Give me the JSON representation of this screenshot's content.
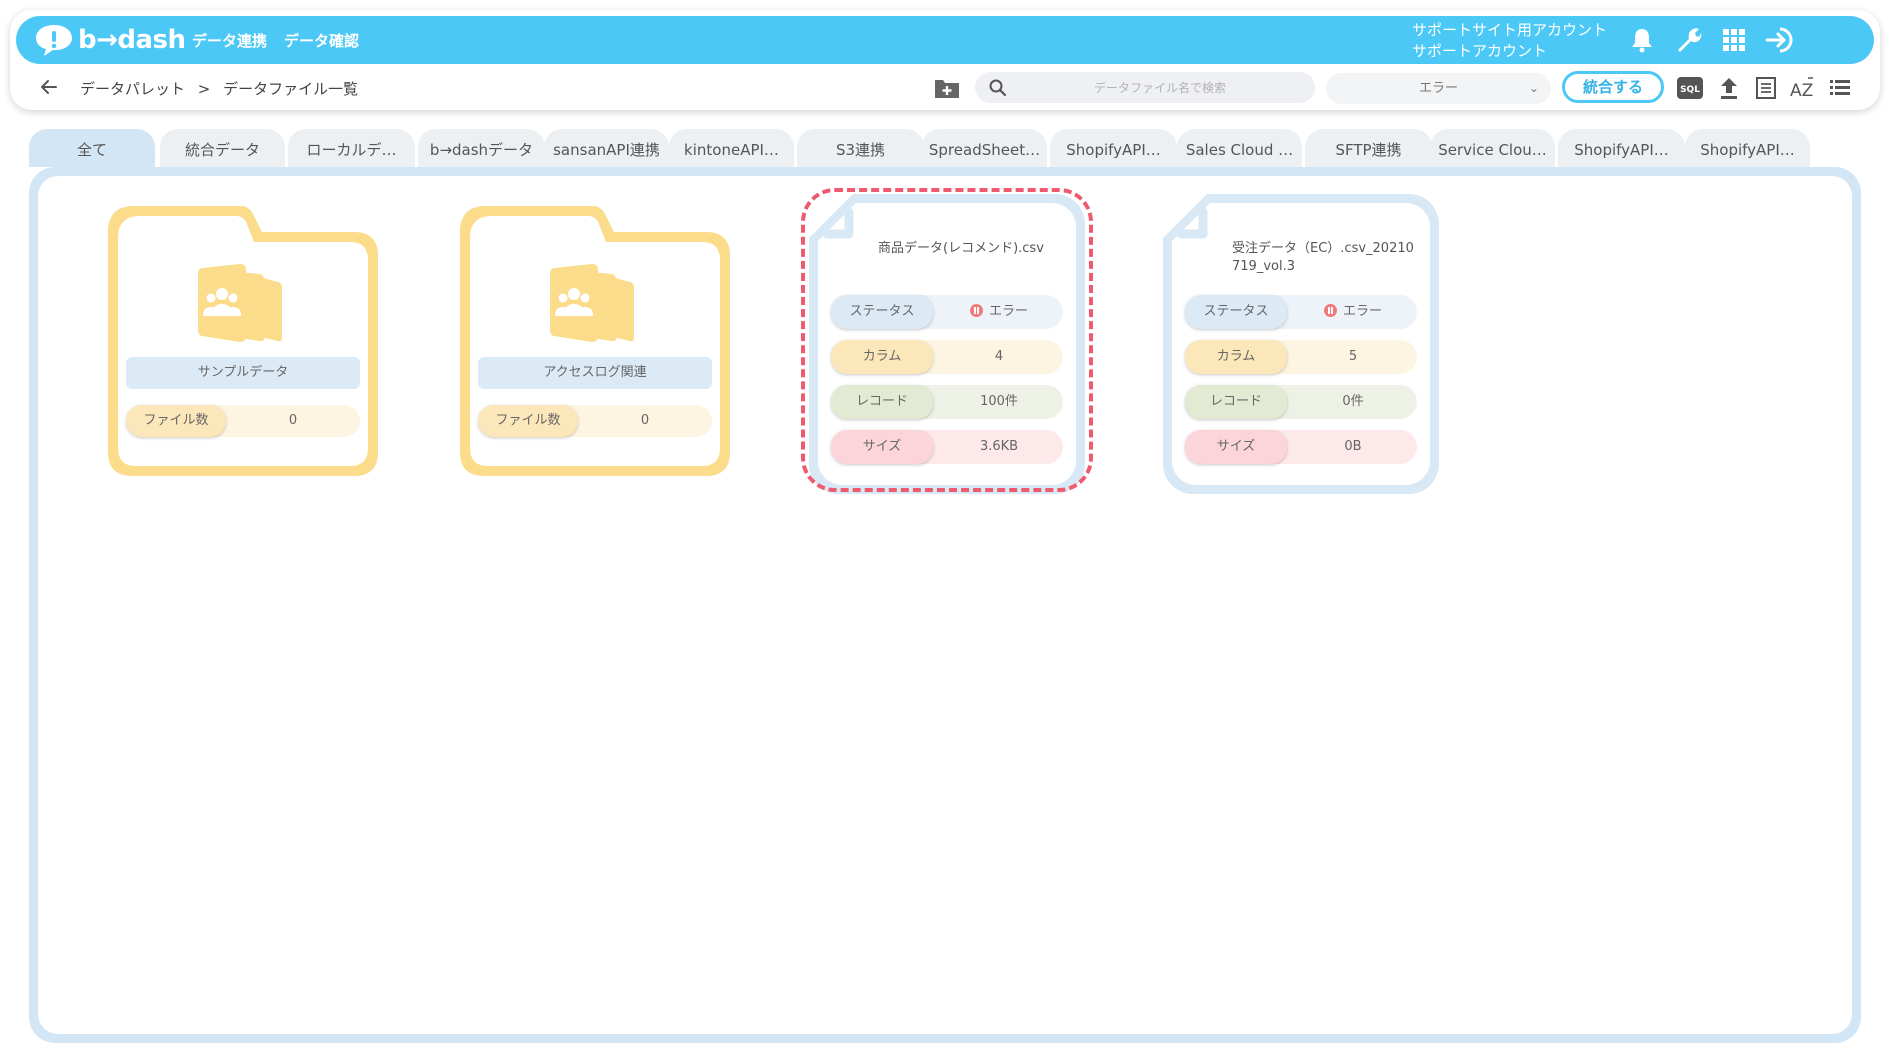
{
  "app": {
    "logo_text": "b→dash",
    "nav": [
      "データ連携",
      "データ確認"
    ],
    "account_line1": "サポートサイト用アカウント",
    "account_line2": "サポートアカウント"
  },
  "header_icons": [
    "bell-icon",
    "wrench-icon",
    "grid-apps-icon",
    "logout-icon"
  ],
  "breadcrumb": {
    "parent": "データパレット",
    "separator": ">",
    "current": "データファイル一覧"
  },
  "search": {
    "placeholder": "データファイル名で検索",
    "value": ""
  },
  "status_filter": {
    "selected": "エラー"
  },
  "merge_button": "統合する",
  "toolbar_icons": [
    "sql-icon",
    "upload-icon",
    "list-view-icon",
    "sort-az-icon",
    "menu-list-icon"
  ],
  "toolbar_labels": {
    "sql": "SQL",
    "az": "AZ"
  },
  "tabs": [
    {
      "label": "全て",
      "active": true
    },
    {
      "label": "統合データ"
    },
    {
      "label": "ローカルデ…"
    },
    {
      "label": "b→dashデータ"
    },
    {
      "label": "sansanAPI連携"
    },
    {
      "label": "kintoneAPI…"
    },
    {
      "label": "S3連携"
    },
    {
      "label": "SpreadSheet…"
    },
    {
      "label": "ShopifyAPI…"
    },
    {
      "label": "Sales Cloud …"
    },
    {
      "label": "SFTP連携"
    },
    {
      "label": "Service Clou…"
    },
    {
      "label": "ShopifyAPI…"
    },
    {
      "label": "ShopifyAPI…"
    }
  ],
  "folders": [
    {
      "name": "サンプルデータ",
      "count_label": "ファイル数",
      "count": "0"
    },
    {
      "name": "アクセスログ関連",
      "count_label": "ファイル数",
      "count": "0"
    }
  ],
  "files": [
    {
      "name": "商品データ(レコメンド).csv",
      "selected": true,
      "status_label": "ステータス",
      "status": "エラー",
      "column_label": "カラム",
      "columns": "4",
      "record_label": "レコード",
      "records": "100件",
      "size_label": "サイズ",
      "size": "3.6KB"
    },
    {
      "name": "受注データ（EC）.csv_20210719_vol.3",
      "selected": false,
      "status_label": "ステータス",
      "status": "エラー",
      "column_label": "カラム",
      "columns": "5",
      "record_label": "レコード",
      "records": "0件",
      "size_label": "サイズ",
      "size": "0B"
    }
  ],
  "colors": {
    "brand": "#4cc8f6",
    "folder": "#fbdc8a",
    "status_row": "#eef3fa",
    "column_row": "#fdf5e2",
    "record_row": "#eef2e6",
    "size_row": "#fde8ea",
    "error": "#f07a7a",
    "selection": "#ef5a6e"
  }
}
